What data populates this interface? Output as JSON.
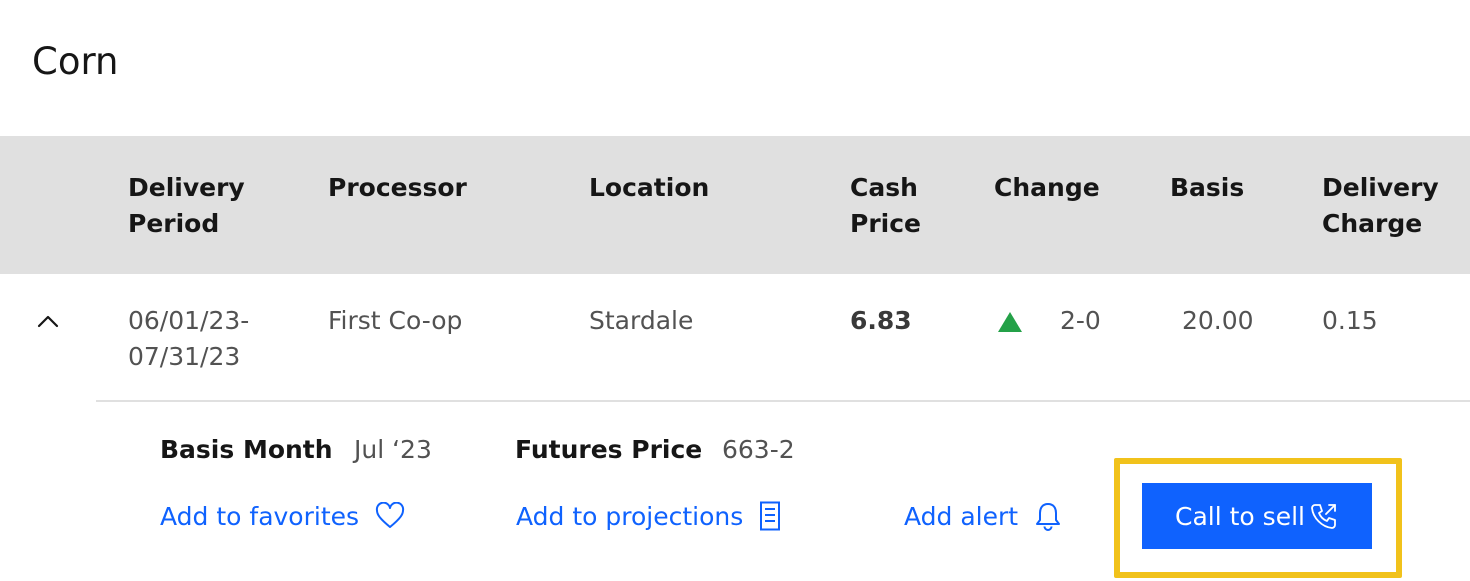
{
  "page": {
    "title": "Corn"
  },
  "table": {
    "headers": [
      {
        "line1": "Delivery",
        "line2": "Period"
      },
      {
        "line1": "Processor",
        "line2": ""
      },
      {
        "line1": "Location",
        "line2": ""
      },
      {
        "line1": "Cash",
        "line2": "Price"
      },
      {
        "line1": "Change",
        "line2": ""
      },
      {
        "line1": "Basis",
        "line2": ""
      },
      {
        "line1": "Delivery",
        "line2": "Charge"
      }
    ],
    "rows": [
      {
        "delivery_period_line1": "06/01/23-",
        "delivery_period_line2": "07/31/23",
        "processor": "First Co-op",
        "location": "Stardale",
        "cash_price": "6.83",
        "change_direction": "up",
        "change": "2-0",
        "basis": "20.00",
        "delivery_charge": "0.15",
        "expanded": true
      }
    ]
  },
  "details": {
    "basis_month_label": "Basis Month",
    "basis_month_value": "Jul ‘23",
    "futures_price_label": "Futures Price",
    "futures_price_value": "663-2"
  },
  "actions": {
    "favorites_label": "Add to favorites",
    "projections_label": "Add to projections",
    "alert_label": "Add alert",
    "call_to_sell_label": "Call to sell"
  },
  "colors": {
    "link": "#0f62fe",
    "button_bg": "#0f62fe",
    "header_bg": "#e0e0e0",
    "highlight": "#f1c21b",
    "up_arrow": "#24a148"
  },
  "icons": {
    "expand": "chevron-up-icon",
    "change": "triangle-up-icon",
    "favorites": "heart-icon",
    "projections": "document-icon",
    "alert": "bell-icon",
    "call": "phone-outgoing-icon"
  }
}
